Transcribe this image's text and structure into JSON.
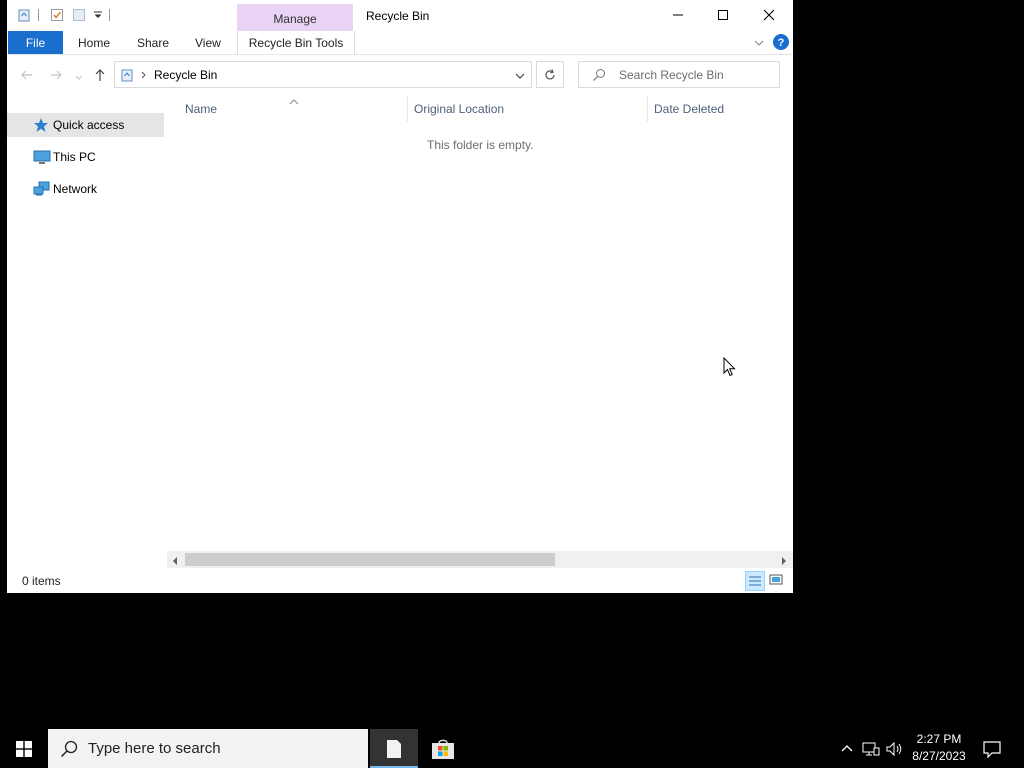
{
  "window": {
    "title": "Recycle Bin",
    "contextual_tab_group": "Manage",
    "ribbon_tabs": {
      "file": "File",
      "home": "Home",
      "share": "Share",
      "view": "View",
      "recycle_bin_tools": "Recycle Bin Tools"
    }
  },
  "address_bar": {
    "path": "Recycle Bin",
    "search_placeholder": "Search Recycle Bin"
  },
  "nav_pane": {
    "items": [
      {
        "label": "Quick access",
        "icon": "star-icon",
        "selected": true
      },
      {
        "label": "This PC",
        "icon": "computer-icon",
        "selected": false
      },
      {
        "label": "Network",
        "icon": "network-icon",
        "selected": false
      }
    ]
  },
  "content": {
    "columns": [
      "Name",
      "Original Location",
      "Date Deleted"
    ],
    "empty_message": "This folder is empty."
  },
  "status_bar": {
    "item_count": "0 items"
  },
  "taskbar": {
    "search_placeholder": "Type here to search",
    "time": "2:27 PM",
    "date": "8/27/2023"
  },
  "colors": {
    "file_tab": "#1a6fce",
    "manage_tab": "#e8d3f5",
    "help": "#1a6fce",
    "selection": "#e5e5e5"
  }
}
